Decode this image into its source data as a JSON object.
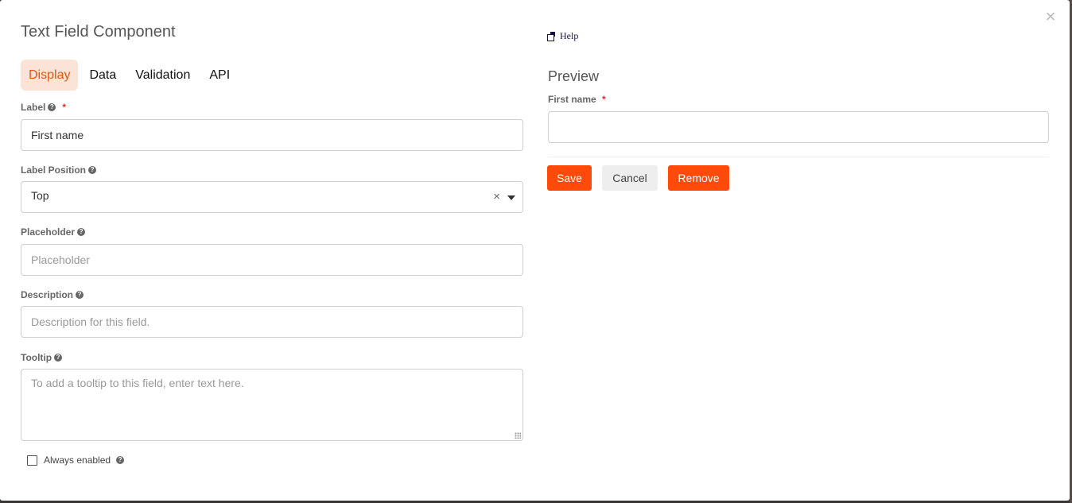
{
  "dialog": {
    "title": "Text Field Component",
    "close_symbol": "×"
  },
  "tabs": [
    {
      "label": "Display",
      "active": true
    },
    {
      "label": "Data",
      "active": false
    },
    {
      "label": "Validation",
      "active": false
    },
    {
      "label": "API",
      "active": false
    }
  ],
  "form": {
    "label": {
      "label": "Label",
      "required_mark": "*",
      "value": "First name",
      "help_icon": "question-circle-icon"
    },
    "label_position": {
      "label": "Label Position",
      "value": "Top",
      "clear_symbol": "×",
      "help_icon": "question-circle-icon"
    },
    "placeholder": {
      "label": "Placeholder",
      "placeholder": "Placeholder",
      "help_icon": "question-circle-icon"
    },
    "description": {
      "label": "Description",
      "placeholder": "Description for this field.",
      "help_icon": "question-circle-icon"
    },
    "tooltip": {
      "label": "Tooltip",
      "placeholder": "To add a tooltip to this field, enter text here.",
      "help_icon": "question-circle-icon"
    },
    "always_enabled": {
      "label": "Always enabled",
      "checked": false
    }
  },
  "help": {
    "label": "Help",
    "icon": "external-window-icon"
  },
  "preview": {
    "title": "Preview",
    "field_label": "First name",
    "required_mark": "*"
  },
  "actions": {
    "save": "Save",
    "cancel": "Cancel",
    "remove": "Remove"
  },
  "colors": {
    "accent": "#ff4a0a",
    "active_tab_bg": "#fbe3d8",
    "active_tab_text": "#e8560e",
    "required": "#d9302c"
  }
}
